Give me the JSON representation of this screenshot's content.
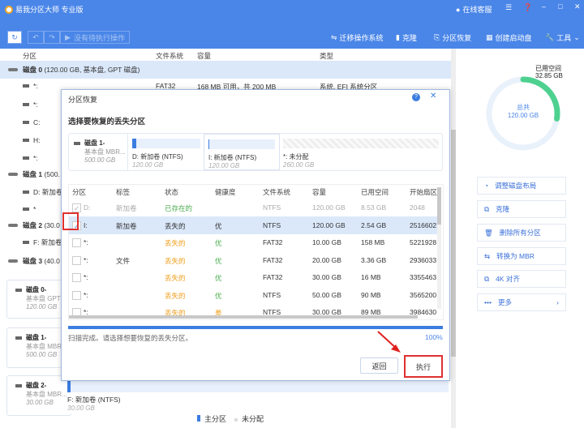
{
  "app": {
    "title": "易我分区大师 专业版",
    "online_service": "在线客服"
  },
  "toolbar": {
    "no_pending": "没有待执行操作",
    "migrate_os": "迁移操作系统",
    "clone": "克隆",
    "partition_recovery": "分区恢复",
    "create_boot": "创建启动盘",
    "tools": "工具"
  },
  "list": {
    "headers": [
      "分区",
      "文件系统",
      "容量",
      "类型"
    ],
    "disk0": {
      "name": "磁盘 0",
      "info": "(120.00 GB, 基本盘, GPT 磁盘)"
    },
    "rows": [
      {
        "name": "*:",
        "fs": "FAT32",
        "cap": "168 MB  可用，共  200 MB",
        "type": "系统, EFI 系统分区"
      },
      {
        "name": "*:"
      },
      {
        "name": "C:"
      },
      {
        "name": "H:"
      },
      {
        "name": "*:"
      }
    ],
    "disk1": {
      "name": "磁盘 1",
      "info": "(500."
    },
    "d1rows": [
      {
        "name": "D: 新加卷"
      },
      {
        "name": "*"
      }
    ],
    "disk2": {
      "name": "磁盘 2",
      "info": "(30.0"
    },
    "d2rows": [
      {
        "name": "F: 新加卷"
      }
    ],
    "disk3": {
      "name": "磁盘 3",
      "info": "(40.0"
    }
  },
  "cards": [
    {
      "name": "磁盘 0-",
      "type": "基本盘 GPT ...",
      "size": "120.00 GB"
    },
    {
      "name": "磁盘 1-",
      "type": "基本盘 MBR...",
      "size": "500.00 GB"
    },
    {
      "name": "磁盘 2-",
      "type": "基本盘 MBR...",
      "size": "30.00 GB"
    }
  ],
  "bottom_part": {
    "label": "F: 新加卷 (NTFS)",
    "size": "30.00 GB"
  },
  "legend": {
    "primary": "主分区",
    "unalloc": "未分配"
  },
  "donut": {
    "used_label": "已用空间",
    "used": "32.85 GB",
    "total_label": "总共",
    "total": "120.00 GB",
    "used_fraction": 0.274
  },
  "right_actions": [
    "调整磁盘布局",
    "克隆",
    "删除所有分区",
    "转换为 MBR",
    "4K 对齐",
    "更多"
  ],
  "dialog": {
    "title": "分区恢复",
    "subtitle": "选择要恢复的丢失分区",
    "disk": {
      "name": "磁盘 1-",
      "type": "基本盘 MBR...",
      "size": "500.00 GB"
    },
    "map": [
      {
        "label": "D: 新加卷 (NTFS)",
        "size": "120.00 GB"
      },
      {
        "label": "I: 新加卷 (NTFS)",
        "size": "120.00 GB"
      },
      {
        "label": "*: 未分配",
        "size": "260.00 GB"
      }
    ],
    "headers": [
      "分区",
      "标签",
      "状态",
      "健康度",
      "文件系统",
      "容量",
      "已用空间",
      "开始扇区"
    ],
    "rows": [
      {
        "p": "D:",
        "label": "新加卷",
        "status": "已存在的",
        "health": "",
        "fs": "NTFS",
        "cap": "120.00 GB",
        "used": "8.53 GB",
        "start": "2048",
        "checked": true,
        "disabled": true
      },
      {
        "p": "I:",
        "label": "新加卷",
        "status": "丢失的",
        "health": "优",
        "fs": "NTFS",
        "cap": "120.00 GB",
        "used": "2.54 GB",
        "start": "2516602",
        "checked": true
      },
      {
        "p": "*:",
        "label": "",
        "status": "丢失的",
        "health": "优",
        "fs": "FAT32",
        "cap": "10.00 GB",
        "used": "158 MB",
        "start": "5221928"
      },
      {
        "p": "*:",
        "label": "文件",
        "status": "丢失的",
        "health": "优",
        "fs": "FAT32",
        "cap": "20.00 GB",
        "used": "3.36 GB",
        "start": "2936033"
      },
      {
        "p": "*:",
        "label": "",
        "status": "丢失的",
        "health": "优",
        "fs": "FAT32",
        "cap": "30.00 GB",
        "used": "16 MB",
        "start": "3355463"
      },
      {
        "p": "*:",
        "label": "",
        "status": "丢失的",
        "health": "优",
        "fs": "NTFS",
        "cap": "50.00 GB",
        "used": "90 MB",
        "start": "3565200"
      },
      {
        "p": "*:",
        "label": "",
        "status": "丢失的",
        "health": "差",
        "fs": "NTFS",
        "cap": "30.00 GB",
        "used": "89 MB",
        "start": "3984630"
      }
    ],
    "status_text": "扫描完成。请选择想要恢复的丢失分区。",
    "progress": "100%",
    "back": "返回",
    "execute": "执行"
  }
}
